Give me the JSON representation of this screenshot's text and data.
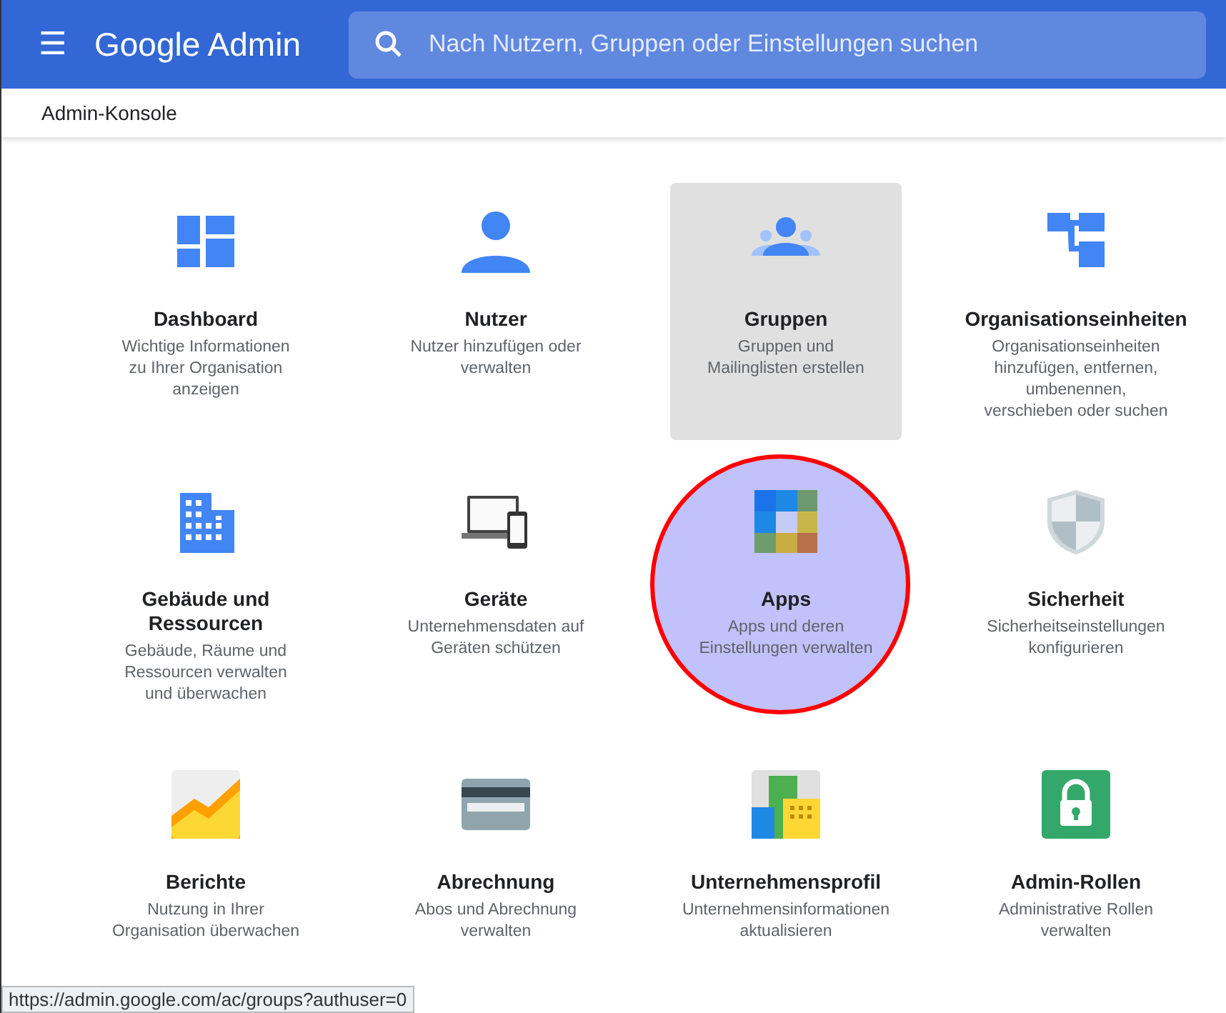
{
  "header": {
    "menu_icon": "☰",
    "logo": "Google Admin",
    "search": {
      "placeholder": "Nach Nutzern, Gruppen oder Einstellungen suchen"
    }
  },
  "breadcrumb": "Admin-Konsole",
  "cards": [
    {
      "title": "Dashboard",
      "description": "Wichtige Informationen zu Ihrer Organisation anzeigen",
      "hovered": false,
      "highlighted": false
    },
    {
      "title": "Nutzer",
      "description": "Nutzer hinzufügen oder verwalten",
      "hovered": false,
      "highlighted": false
    },
    {
      "title": "Gruppen",
      "description": "Gruppen und Mailinglisten erstellen",
      "hovered": true,
      "highlighted": false
    },
    {
      "title": "Organisationseinheiten",
      "description": "Organisationseinheiten hinzufügen, entfernen, umbenennen, verschieben oder suchen",
      "hovered": false,
      "highlighted": false
    },
    {
      "title": "Gebäude und Ressourcen",
      "description": "Gebäude, Räume und Ressourcen verwalten und überwachen",
      "hovered": false,
      "highlighted": false
    },
    {
      "title": "Geräte",
      "description": "Unternehmensdaten auf Geräten schützen",
      "hovered": false,
      "highlighted": false
    },
    {
      "title": "Apps",
      "description": "Apps und deren Einstellungen verwalten",
      "hovered": false,
      "highlighted": true
    },
    {
      "title": "Sicherheit",
      "description": "Sicherheitseinstellungen konfigurieren",
      "hovered": false,
      "highlighted": false
    },
    {
      "title": "Berichte",
      "description": "Nutzung in Ihrer Organisation überwachen",
      "hovered": false,
      "highlighted": false
    },
    {
      "title": "Abrechnung",
      "description": "Abos und Abrechnung verwalten",
      "hovered": false,
      "highlighted": false
    },
    {
      "title": "Unternehmensprofil",
      "description": "Unternehmensinformationen aktualisieren",
      "hovered": false,
      "highlighted": false
    },
    {
      "title": "Admin-Rollen",
      "description": "Administrative Rollen verwalten",
      "hovered": false,
      "highlighted": false
    }
  ],
  "status_url": "https://admin.google.com/ac/groups?authuser=0"
}
